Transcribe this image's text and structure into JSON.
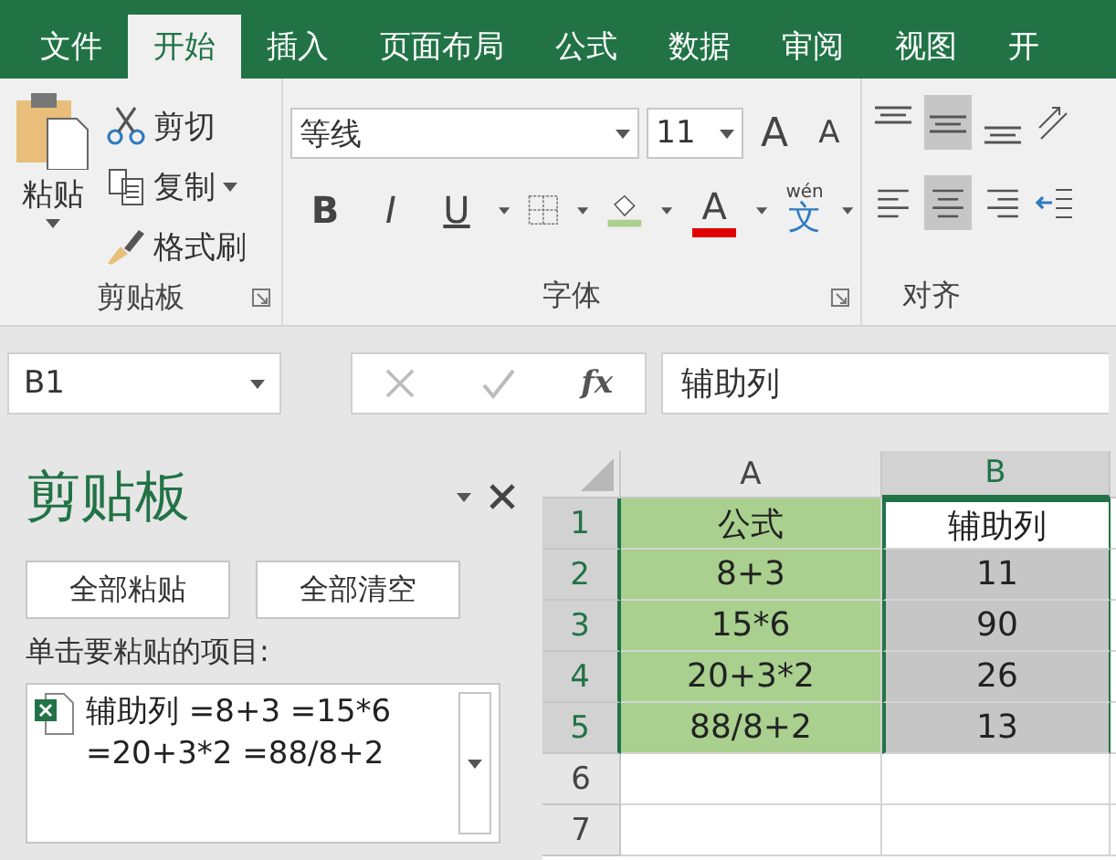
{
  "tabs": [
    {
      "label": "文件",
      "selected": false
    },
    {
      "label": "开始",
      "selected": true
    },
    {
      "label": "插入",
      "selected": false
    },
    {
      "label": "页面布局",
      "selected": false
    },
    {
      "label": "公式",
      "selected": false
    },
    {
      "label": "数据",
      "selected": false
    },
    {
      "label": "审阅",
      "selected": false
    },
    {
      "label": "视图",
      "selected": false
    },
    {
      "label": "开",
      "selected": false
    }
  ],
  "ribbon": {
    "clipboard": {
      "paste": "粘贴",
      "cut": "剪切",
      "copy": "复制",
      "format_painter": "格式刷",
      "group_label": "剪贴板"
    },
    "font": {
      "font_name": "等线",
      "font_size": "11",
      "grow": "A",
      "shrink": "A",
      "bold": "B",
      "italic": "I",
      "underline": "U",
      "font_color": "A",
      "phonetic": "wén",
      "phonetic_char": "文",
      "group_label": "字体"
    },
    "alignment": {
      "group_label": "对齐"
    }
  },
  "formula_bar": {
    "name_box": "B1",
    "fx": "fx",
    "value": "辅助列"
  },
  "clipboard_pane": {
    "title": "剪贴板",
    "buttons": [
      "全部粘贴",
      "全部清空"
    ],
    "prompt": "单击要粘贴的项目:",
    "items": [
      {
        "lines": [
          "辅助列 =8+3 =15*6",
          "=20+3*2 =88/8+2"
        ]
      }
    ]
  },
  "sheet": {
    "columns": [
      {
        "label": "A",
        "selected": false
      },
      {
        "label": "B",
        "selected": true
      }
    ],
    "rows": [
      {
        "label": "1",
        "selected": true,
        "cells": [
          {
            "text": "公式",
            "color": "#a9d08e",
            "selected": false,
            "active": false
          },
          {
            "text": "辅助列",
            "selected": true,
            "active": true
          }
        ]
      },
      {
        "label": "2",
        "selected": true,
        "cells": [
          {
            "text": "8+3",
            "color": "#a9d08e",
            "selected": false,
            "active": false
          },
          {
            "text": "11",
            "selected": true,
            "active": false
          }
        ]
      },
      {
        "label": "3",
        "selected": true,
        "cells": [
          {
            "text": "15*6",
            "color": "#a9d08e",
            "selected": false,
            "active": false
          },
          {
            "text": "90",
            "selected": true,
            "active": false
          }
        ]
      },
      {
        "label": "4",
        "selected": true,
        "cells": [
          {
            "text": "20+3*2",
            "color": "#a9d08e",
            "selected": false,
            "active": false
          },
          {
            "text": "26",
            "selected": true,
            "active": false
          }
        ]
      },
      {
        "label": "5",
        "selected": true,
        "cells": [
          {
            "text": "88/8+2",
            "color": "#a9d08e",
            "selected": false,
            "active": false
          },
          {
            "text": "13",
            "selected": true,
            "active": false
          }
        ]
      },
      {
        "label": "6",
        "selected": false,
        "cells": [
          {
            "selected": false,
            "active": false
          },
          {
            "selected": false,
            "active": false
          }
        ]
      },
      {
        "label": "7",
        "selected": false,
        "cells": [
          {
            "selected": false,
            "active": false
          },
          {
            "selected": false,
            "active": false
          }
        ]
      }
    ]
  }
}
